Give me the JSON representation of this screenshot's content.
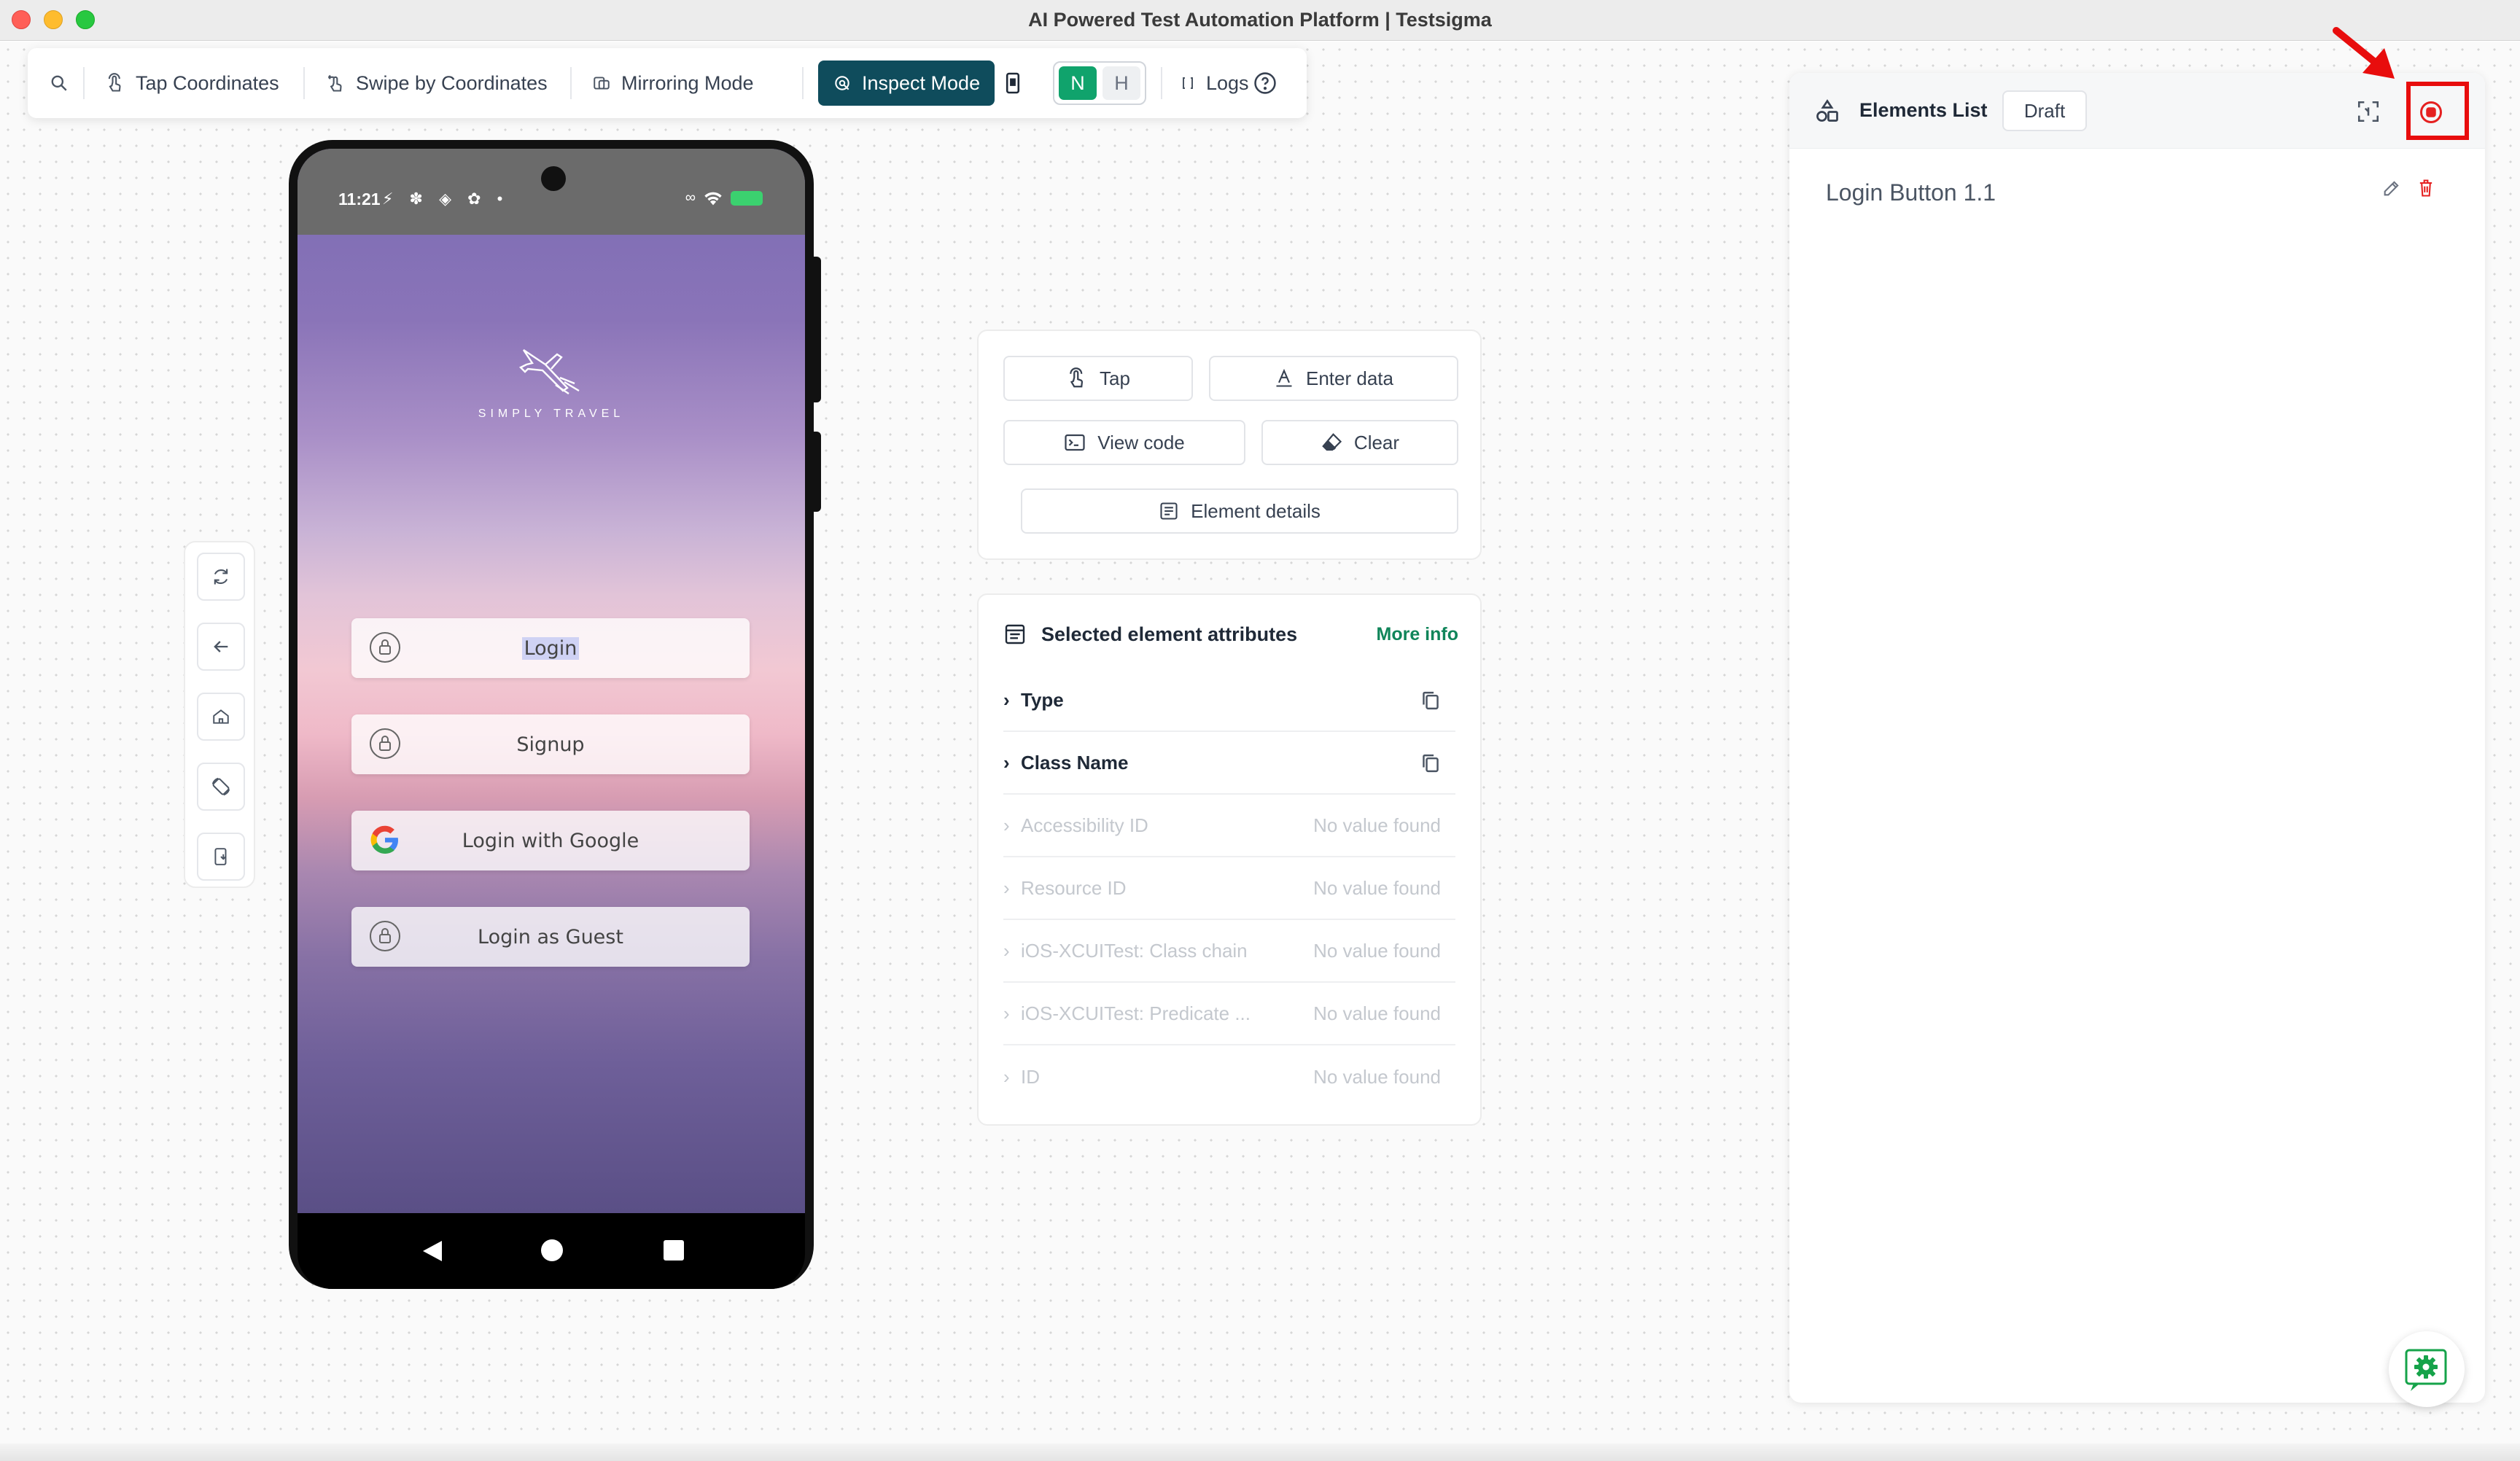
{
  "window": {
    "title": "AI Powered Test Automation Platform | Testsigma"
  },
  "toolbar": {
    "search_icon": "search-icon",
    "tap_coordinates": "Tap Coordinates",
    "swipe_by_coordinates": "Swipe by Coordinates",
    "mirroring_mode": "Mirroring Mode",
    "inspect_mode": "Inspect Mode",
    "toggle_n": "N",
    "toggle_h": "H",
    "logs": "Logs",
    "help_icon": "help-icon"
  },
  "side_controls": [
    "refresh-icon",
    "back-arrow-icon",
    "home-icon",
    "rotate-icon",
    "install-app-icon"
  ],
  "phone": {
    "status_time": "11:21",
    "status_icons": "⚡ ✽ ◈ ✿ •",
    "app_logo_text": "SIMPLY TRAVEL",
    "buttons": {
      "login": "Login",
      "signup": "Signup",
      "login_google": "Login with Google",
      "login_guest": "Login as Guest"
    }
  },
  "actions": {
    "tap": "Tap",
    "enter_data": "Enter data",
    "view_code": "View code",
    "clear": "Clear",
    "element_details": "Element details"
  },
  "attributes": {
    "title": "Selected element attributes",
    "more_info": "More info",
    "no_value": "No value found",
    "rows": {
      "type": "Type",
      "class_name": "Class Name",
      "accessibility_id": "Accessibility ID",
      "resource_id": "Resource ID",
      "ios_class_chain": "iOS-XCUITest: Class chain",
      "ios_predicate": "iOS-XCUITest: Predicate ...",
      "id": "ID"
    }
  },
  "elements_list": {
    "title": "Elements List",
    "badge": "Draft",
    "items": [
      "Login Button 1.1"
    ]
  },
  "colors": {
    "inspect_active": "#0f4c5c",
    "toggle_n": "#10a36c",
    "more_info": "#10855a",
    "highlight_red": "#e80d0d"
  }
}
